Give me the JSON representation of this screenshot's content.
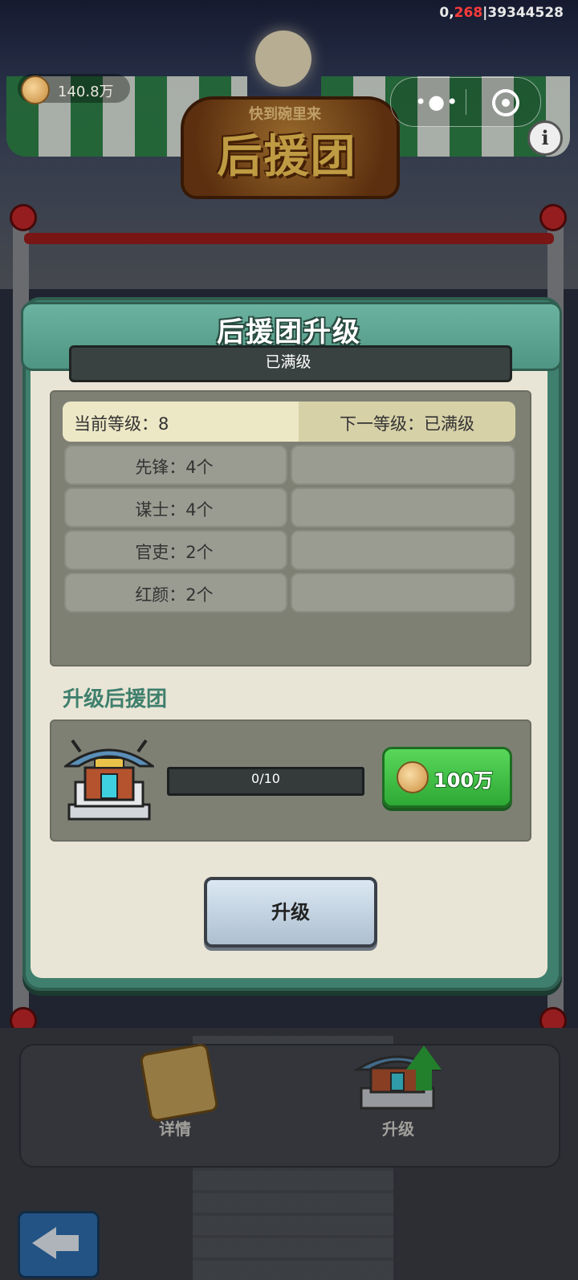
{
  "status_bar": {
    "prefix": "0,",
    "highlight": "268",
    "suffix": "|39344528"
  },
  "header": {
    "coins": "140.8万",
    "logo_small": "快到碗里来",
    "logo_big": "后援团"
  },
  "capsule": {
    "more_glyph": "•●•"
  },
  "info_glyph": "i",
  "modal": {
    "title": "后援团升级",
    "subtitle": "已满级",
    "current_level": "当前等级：8",
    "next_level": "下一等级：已满级",
    "slots": [
      {
        "left": "先锋：4个",
        "right": ""
      },
      {
        "left": "谋士：4个",
        "right": ""
      },
      {
        "left": "官吏：2个",
        "right": ""
      },
      {
        "left": "红颜：2个",
        "right": ""
      }
    ],
    "section_title": "升级后援团",
    "progress": {
      "text": "0/10",
      "fraction": 0
    },
    "cost": "100万",
    "upgrade_button": "升级"
  },
  "bottom": {
    "details_label": "详情",
    "upgrade_label": "升级"
  },
  "colors": {
    "accent": "#3f7f6d",
    "green": "#2ea935",
    "panel": "#e9e5d6",
    "red": "#c8272a"
  }
}
